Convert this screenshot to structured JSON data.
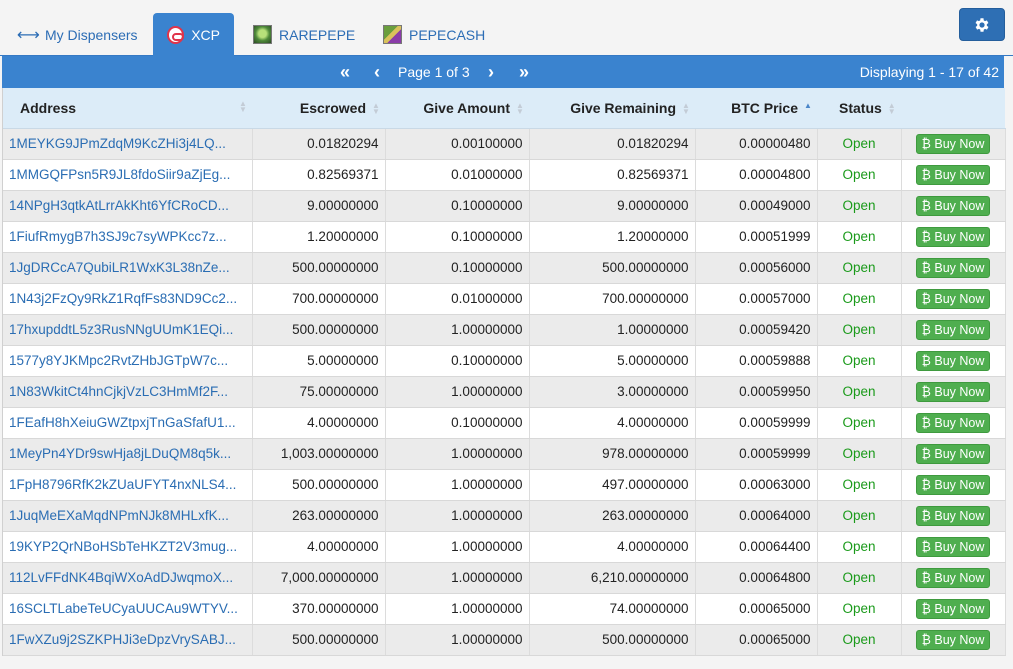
{
  "tabs": [
    {
      "label": "My Dispensers",
      "icon": "left-right-arrows-icon",
      "active": false
    },
    {
      "label": "XCP",
      "icon": "xcp-token-icon",
      "active": true
    },
    {
      "label": "RAREPEPE",
      "icon": "rarepepe-thumbnail-icon",
      "active": false
    },
    {
      "label": "PEPECASH",
      "icon": "pepecash-thumbnail-icon",
      "active": false
    }
  ],
  "settings_icon": "gear-icon",
  "pager": {
    "first_icon": "double-chevron-left-icon",
    "prev_icon": "chevron-left-icon",
    "next_icon": "chevron-right-icon",
    "last_icon": "double-chevron-right-icon",
    "page_text": "Page 1 of 3",
    "display_text": "Displaying 1 - 17 of 42"
  },
  "columns": {
    "address": "Address",
    "escrowed": "Escrowed",
    "give_amount": "Give Amount",
    "give_remaining": "Give Remaining",
    "btc_price": "BTC Price",
    "status": "Status",
    "sort_active": "btc_price-ascending"
  },
  "buy_label": "₿ Buy Now",
  "colors": {
    "accent": "#3a83cf",
    "status_open": "#1a9a1a",
    "buy_button": "#4fae4f",
    "link": "#2a6db3"
  },
  "rows": [
    {
      "address": "1MEYKG9JPmZdqM9KcZHi3j4LQ...",
      "escrowed": "0.01820294",
      "give_amount": "0.00100000",
      "give_remaining": "0.01820294",
      "btc_price": "0.00000480",
      "status": "Open"
    },
    {
      "address": "1MMGQFPsn5R9JL8fdoSiir9aZjEg...",
      "escrowed": "0.82569371",
      "give_amount": "0.01000000",
      "give_remaining": "0.82569371",
      "btc_price": "0.00004800",
      "status": "Open"
    },
    {
      "address": "14NPgH3qtkAtLrrAkKht6YfCRoCD...",
      "escrowed": "9.00000000",
      "give_amount": "0.10000000",
      "give_remaining": "9.00000000",
      "btc_price": "0.00049000",
      "status": "Open"
    },
    {
      "address": "1FiufRmygB7h3SJ9c7syWPKcc7z...",
      "escrowed": "1.20000000",
      "give_amount": "0.10000000",
      "give_remaining": "1.20000000",
      "btc_price": "0.00051999",
      "status": "Open"
    },
    {
      "address": "1JgDRCcA7QubiLR1WxK3L38nZe...",
      "escrowed": "500.00000000",
      "give_amount": "0.10000000",
      "give_remaining": "500.00000000",
      "btc_price": "0.00056000",
      "status": "Open"
    },
    {
      "address": "1N43j2FzQy9RkZ1RqfFs83ND9Cc2...",
      "escrowed": "700.00000000",
      "give_amount": "0.01000000",
      "give_remaining": "700.00000000",
      "btc_price": "0.00057000",
      "status": "Open"
    },
    {
      "address": "17hxupddtL5z3RusNNgUUmK1EQi...",
      "escrowed": "500.00000000",
      "give_amount": "1.00000000",
      "give_remaining": "1.00000000",
      "btc_price": "0.00059420",
      "status": "Open"
    },
    {
      "address": "1577y8YJKMpc2RvtZHbJGTpW7c...",
      "escrowed": "5.00000000",
      "give_amount": "0.10000000",
      "give_remaining": "5.00000000",
      "btc_price": "0.00059888",
      "status": "Open"
    },
    {
      "address": "1N83WkitCt4hnCjkjVzLC3HmMf2F...",
      "escrowed": "75.00000000",
      "give_amount": "1.00000000",
      "give_remaining": "3.00000000",
      "btc_price": "0.00059950",
      "status": "Open"
    },
    {
      "address": "1FEafH8hXeiuGWZtpxjTnGaSfafU1...",
      "escrowed": "4.00000000",
      "give_amount": "0.10000000",
      "give_remaining": "4.00000000",
      "btc_price": "0.00059999",
      "status": "Open"
    },
    {
      "address": "1MeyPn4YDr9swHja8jLDuQM8q5k...",
      "escrowed": "1,003.00000000",
      "give_amount": "1.00000000",
      "give_remaining": "978.00000000",
      "btc_price": "0.00059999",
      "status": "Open"
    },
    {
      "address": "1FpH8796RfK2kZUaUFYT4nxNLS4...",
      "escrowed": "500.00000000",
      "give_amount": "1.00000000",
      "give_remaining": "497.00000000",
      "btc_price": "0.00063000",
      "status": "Open"
    },
    {
      "address": "1JuqMeEXaMqdNPmNJk8MHLxfK...",
      "escrowed": "263.00000000",
      "give_amount": "1.00000000",
      "give_remaining": "263.00000000",
      "btc_price": "0.00064000",
      "status": "Open"
    },
    {
      "address": "19KYP2QrNBoHSbTeHKZT2V3mug...",
      "escrowed": "4.00000000",
      "give_amount": "1.00000000",
      "give_remaining": "4.00000000",
      "btc_price": "0.00064400",
      "status": "Open"
    },
    {
      "address": "112LvFFdNK4BqiWXoAdDJwqmoX...",
      "escrowed": "7,000.00000000",
      "give_amount": "1.00000000",
      "give_remaining": "6,210.00000000",
      "btc_price": "0.00064800",
      "status": "Open"
    },
    {
      "address": "16SCLTLabeTeUCyaUUCAu9WTYV...",
      "escrowed": "370.00000000",
      "give_amount": "1.00000000",
      "give_remaining": "74.00000000",
      "btc_price": "0.00065000",
      "status": "Open"
    },
    {
      "address": "1FwXZu9j2SZKPHJi3eDpzVrySABJ...",
      "escrowed": "500.00000000",
      "give_amount": "1.00000000",
      "give_remaining": "500.00000000",
      "btc_price": "0.00065000",
      "status": "Open"
    }
  ]
}
